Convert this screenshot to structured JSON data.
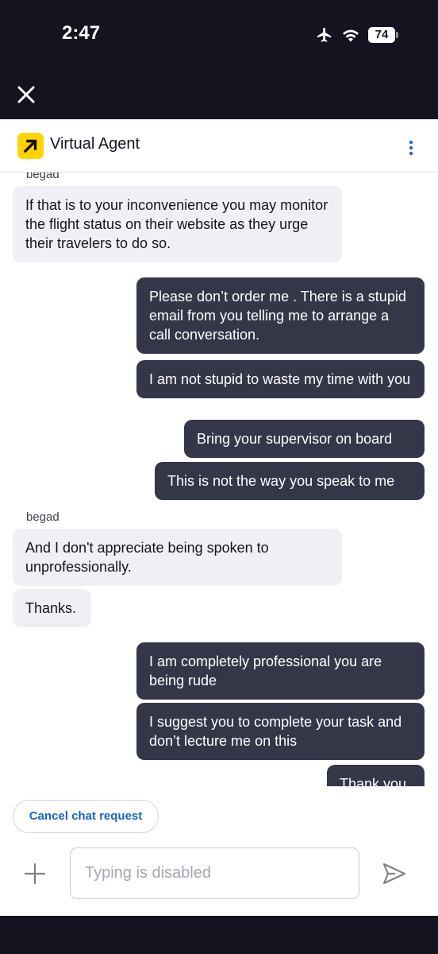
{
  "status_bar": {
    "time": "2:47",
    "battery": "74",
    "icons": [
      "airplane-icon",
      "wifi-icon",
      "battery-icon"
    ]
  },
  "top": {
    "close_icon": "close-icon"
  },
  "header": {
    "title": "Virtual Agent",
    "logo_icon": "arrow-up-right-icon",
    "menu_icon": "more-vertical-icon",
    "logo_color": "#ffd400"
  },
  "chat": {
    "sender_1": "begad",
    "agent_1": "If that is to your inconvenience you may monitor the flight status on their website as they urge their travelers to do so.",
    "user_1": "Please don’t order me . There is a stupid email from you telling me to arrange a call conversation.",
    "user_2": "I am not stupid to waste my time with you",
    "user_3": "Bring your supervisor on board",
    "user_4": "This is not the way you speak to me",
    "sender_2": "begad",
    "agent_2": "And I don't appreciate being spoken to unprofessionally.",
    "agent_3": "Thanks.",
    "user_5": "I am completely professional you are being rude",
    "user_6": "I suggest you to complete your task and don’t lecture me on this",
    "user_7": "Thank you"
  },
  "footer": {
    "cancel_label": "Cancel chat request",
    "input_placeholder": "Typing is disabled",
    "plus_icon": "plus-icon",
    "send_icon": "send-icon"
  },
  "colors": {
    "dark_bar": "#13141f",
    "agent_bubble": "#eef0f5",
    "user_bubble": "#333748",
    "link_blue": "#1b63c6"
  }
}
